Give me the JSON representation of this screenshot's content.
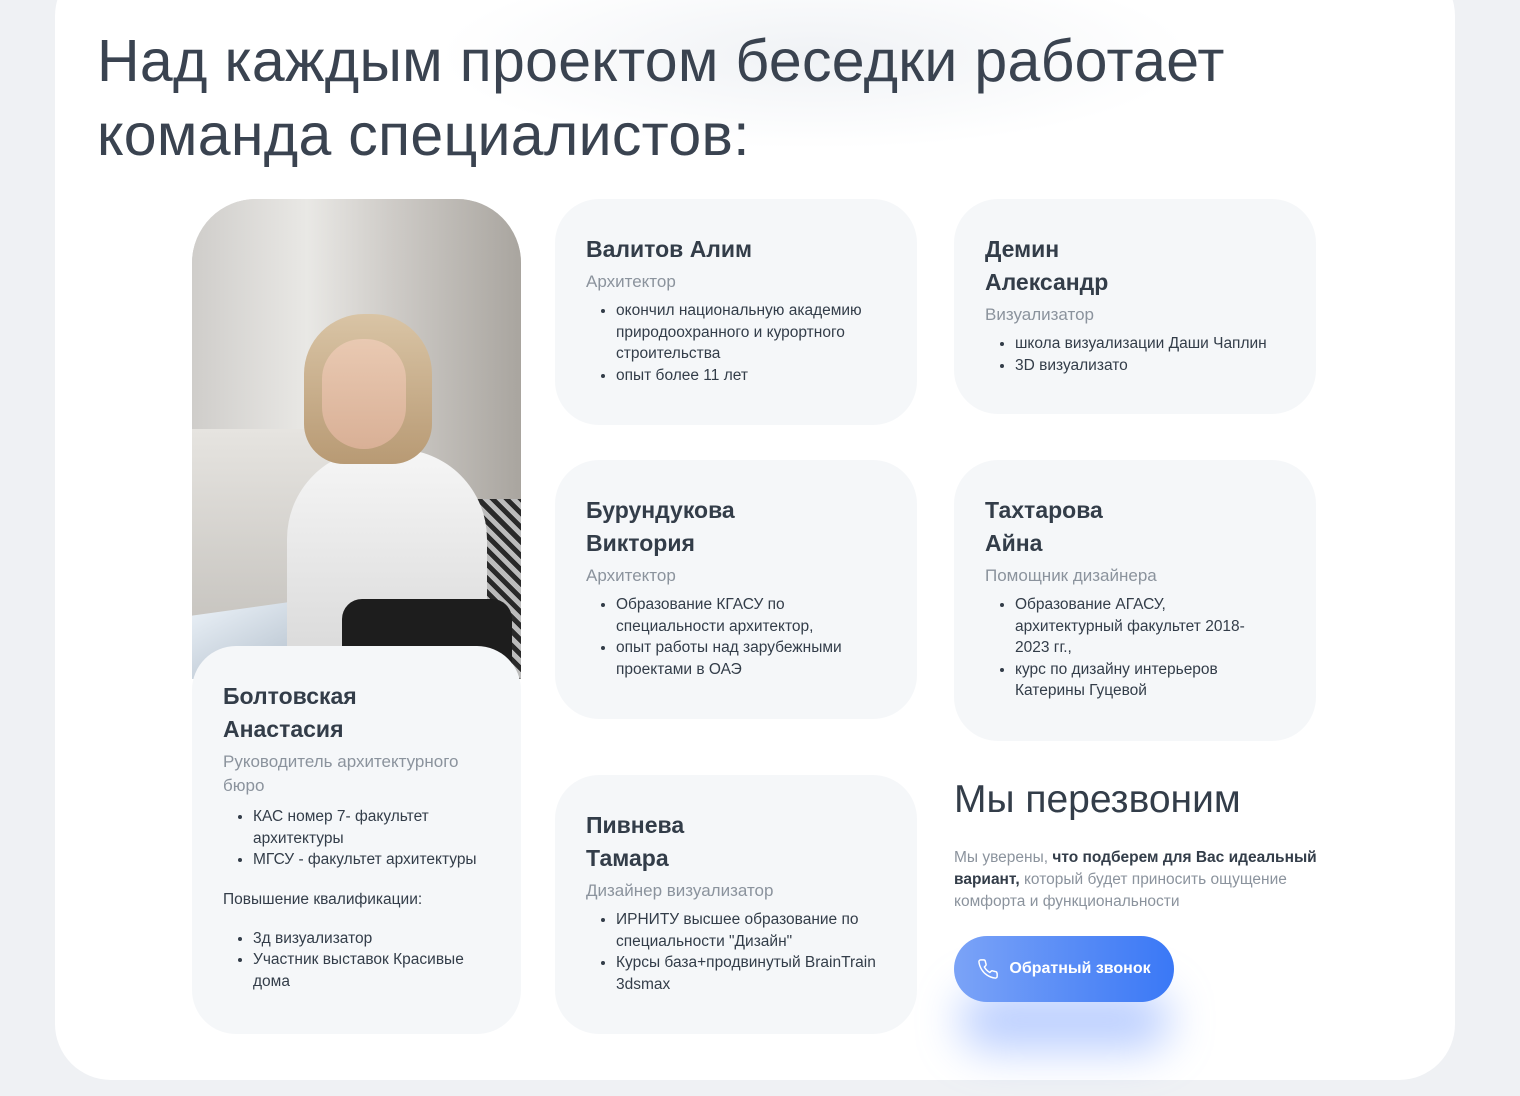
{
  "heading": "Над каждым проектом беседки работает команда специалистов:",
  "featured": {
    "name": "Болтовская Анастасия",
    "role": "Руководитель архитектурного бюро",
    "education": [
      "КАС номер 7- факультет архитектуры",
      "МГСУ - факультет архитектуры"
    ],
    "subheading": "Повышение квалификации:",
    "extra": [
      "3д визуализатор",
      "Участник выставок Красивые дома"
    ]
  },
  "team": [
    {
      "name": "Валитов Алим",
      "role": "Архитектор",
      "points": [
        "окончил национальную академию природоохранного и курортного строительства",
        "опыт более 11 лет"
      ]
    },
    {
      "name": "Демин Александр",
      "role": "Визуализатор",
      "points": [
        "школа визуализации Даши Чаплин",
        "3D визуализато"
      ]
    },
    {
      "name": "Бурундукова Виктория",
      "role": "Архитектор",
      "points": [
        "Образование КГАСУ по специальности архитектор,",
        "опыт работы над зарубежными проектами в ОАЭ"
      ]
    },
    {
      "name": "Тахтарова Айна",
      "role": "Помощник дизайнера",
      "points": [
        "Образование АГАСУ, архитектурный факультет 2018-2023 гг.,",
        "курс по дизайну интерьеров Катерины Гуцевой"
      ]
    },
    {
      "name": "Пивнева Тамара",
      "role": "Дизайнер визуализатор",
      "points": [
        "ИРНИТУ высшее образование по специальности \"Дизайн\"",
        "Курсы база+продвинутый BrainTrain 3dsmax"
      ]
    }
  ],
  "callback": {
    "title": "Мы перезвоним",
    "text_prefix": "Мы уверены, ",
    "text_bold": "что подберем для Вас идеальный вариант,",
    "text_suffix": " который будет приносить ощущение комфорта и функциональности",
    "button_label": "Обратный звонок",
    "button_icon": "phone-icon"
  },
  "colors": {
    "accent_start": "#7ba3f7",
    "accent_end": "#3a78f6",
    "card_bg": "#f5f7f9",
    "text_dark": "#333d49",
    "text_muted": "#8b939d"
  }
}
